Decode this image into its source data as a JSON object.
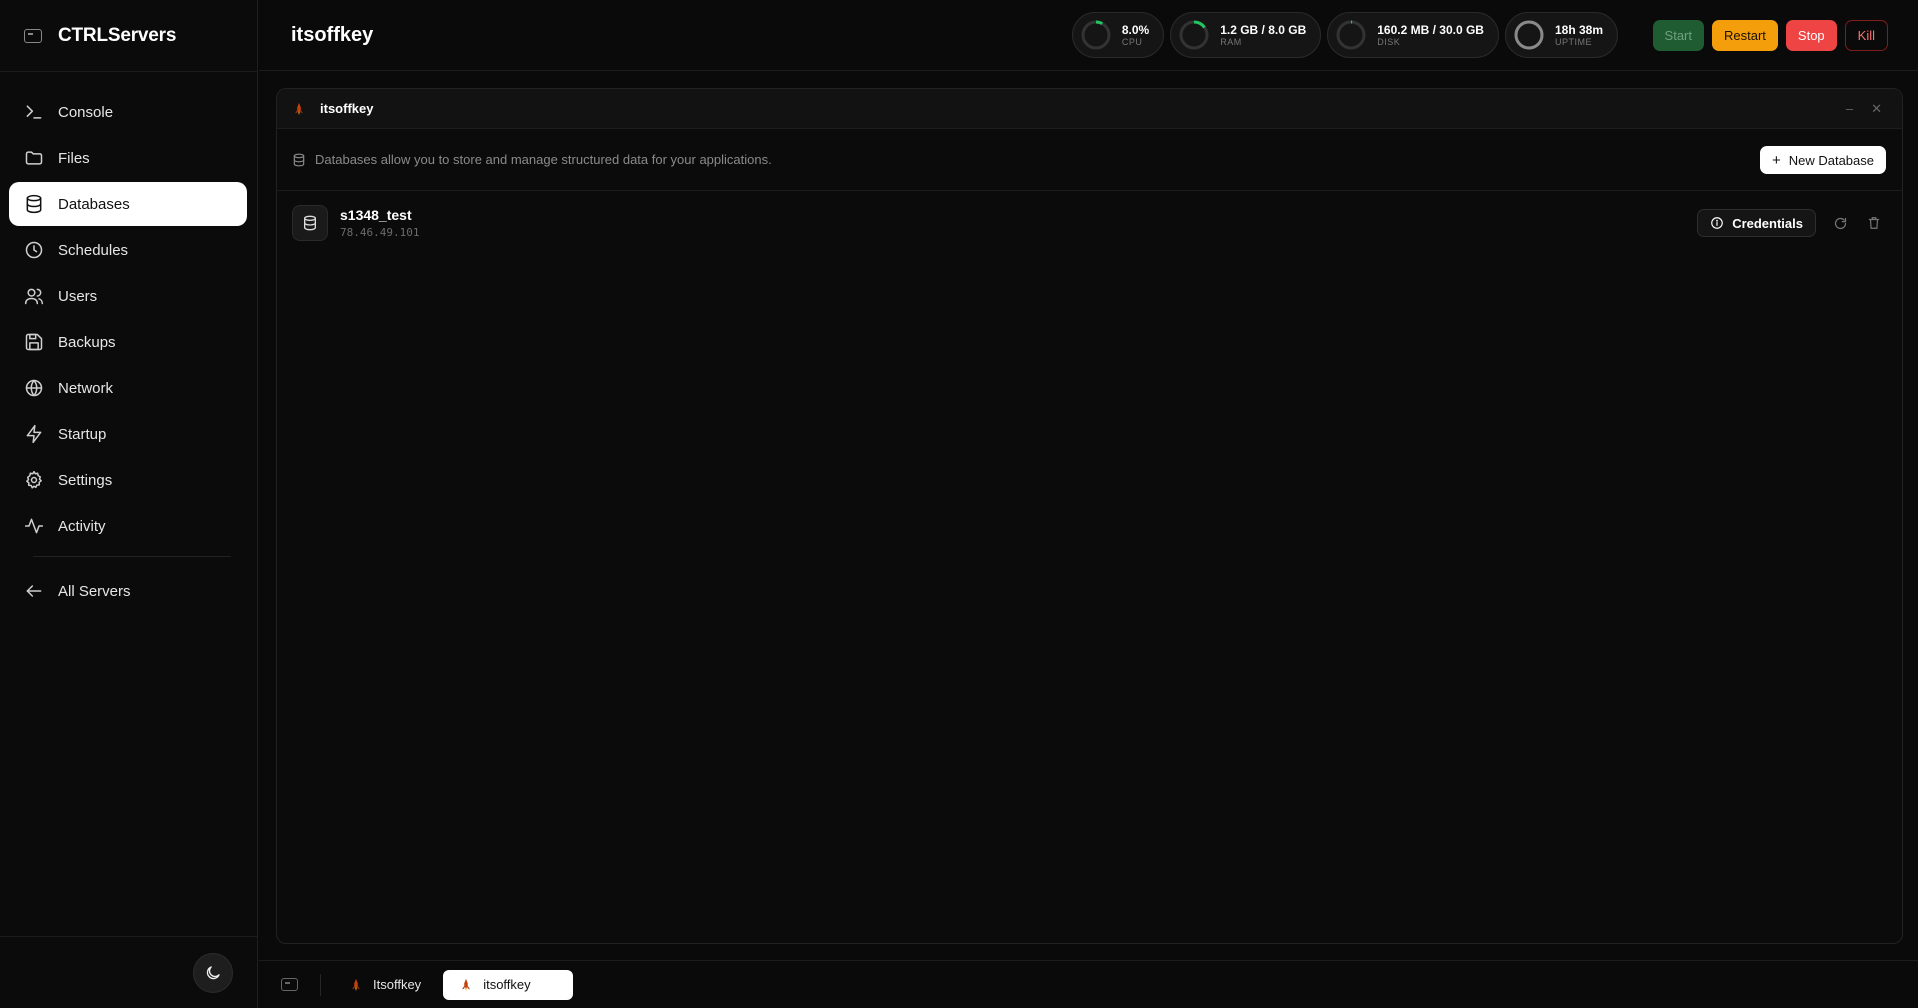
{
  "app": {
    "brand": "CTRLServers",
    "server_name": "itsoffkey"
  },
  "sidebar": {
    "items": [
      {
        "label": "Console",
        "icon": "terminal-icon"
      },
      {
        "label": "Files",
        "icon": "folder-icon"
      },
      {
        "label": "Databases",
        "icon": "database-icon",
        "active": true
      },
      {
        "label": "Schedules",
        "icon": "clock-icon"
      },
      {
        "label": "Users",
        "icon": "users-icon"
      },
      {
        "label": "Backups",
        "icon": "save-icon"
      },
      {
        "label": "Network",
        "icon": "globe-icon"
      },
      {
        "label": "Startup",
        "icon": "bolt-icon"
      },
      {
        "label": "Settings",
        "icon": "gear-icon"
      },
      {
        "label": "Activity",
        "icon": "activity-icon"
      }
    ],
    "back_label": "All Servers"
  },
  "stats": {
    "cpu": {
      "value": "8.0%",
      "label": "CPU",
      "fraction": 0.08
    },
    "ram": {
      "value": "1.2 GB / 8.0 GB",
      "label": "RAM",
      "fraction": 0.15
    },
    "disk": {
      "value": "160.2 MB / 30.0 GB",
      "label": "DISK",
      "fraction": 0.005
    },
    "uptime": {
      "value": "18h 38m",
      "label": "UPTIME",
      "fraction": 1.0
    }
  },
  "power": {
    "start": "Start",
    "restart": "Restart",
    "stop": "Stop",
    "kill": "Kill"
  },
  "panel": {
    "title": "itsoffkey",
    "description": "Databases allow you to store and manage structured data for your applications.",
    "new_button": "New Database"
  },
  "databases": [
    {
      "name": "s1348_test",
      "host": "78.46.49.101",
      "credentials_label": "Credentials"
    }
  ],
  "taskbar": {
    "tabs": [
      {
        "label": "Itsoffkey"
      },
      {
        "label": "itsoffkey",
        "active": true
      }
    ]
  },
  "colors": {
    "accent_green": "#22c55e",
    "restart": "#f59e0b",
    "stop": "#ef4444"
  }
}
